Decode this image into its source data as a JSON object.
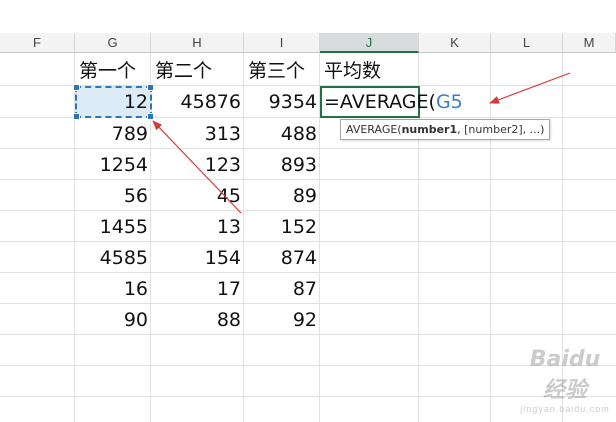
{
  "columns": {
    "F": "F",
    "G": "G",
    "H": "H",
    "I": "I",
    "J": "J",
    "K": "K",
    "L": "L",
    "M": "M"
  },
  "headers": {
    "g": "第一个",
    "h": "第二个",
    "i": "第三个",
    "j": "平均数"
  },
  "rows": [
    {
      "g": "12",
      "h": "45876",
      "i": "9354"
    },
    {
      "g": "789",
      "h": "313",
      "i": "488"
    },
    {
      "g": "1254",
      "h": "123",
      "i": "893"
    },
    {
      "g": "56",
      "h": "45",
      "i": "89"
    },
    {
      "g": "1455",
      "h": "13",
      "i": "152"
    },
    {
      "g": "4585",
      "h": "154",
      "i": "874"
    },
    {
      "g": "16",
      "h": "17",
      "i": "87"
    },
    {
      "g": "90",
      "h": "88",
      "i": "92"
    }
  ],
  "formula": {
    "prefix": "=AVERAGE(",
    "reference": "G5"
  },
  "tooltip": {
    "function_name": "AVERAGE(",
    "bold_param": "number1",
    "rest": ", [number2], ...)"
  },
  "watermark": {
    "main": "Baidu经验",
    "sub": "jingyan.baidu.com"
  },
  "colors": {
    "selection_border": "#2e75b6",
    "edit_border": "#217346",
    "reference_text": "#3b7bc8",
    "arrow": "#d33b3b"
  }
}
